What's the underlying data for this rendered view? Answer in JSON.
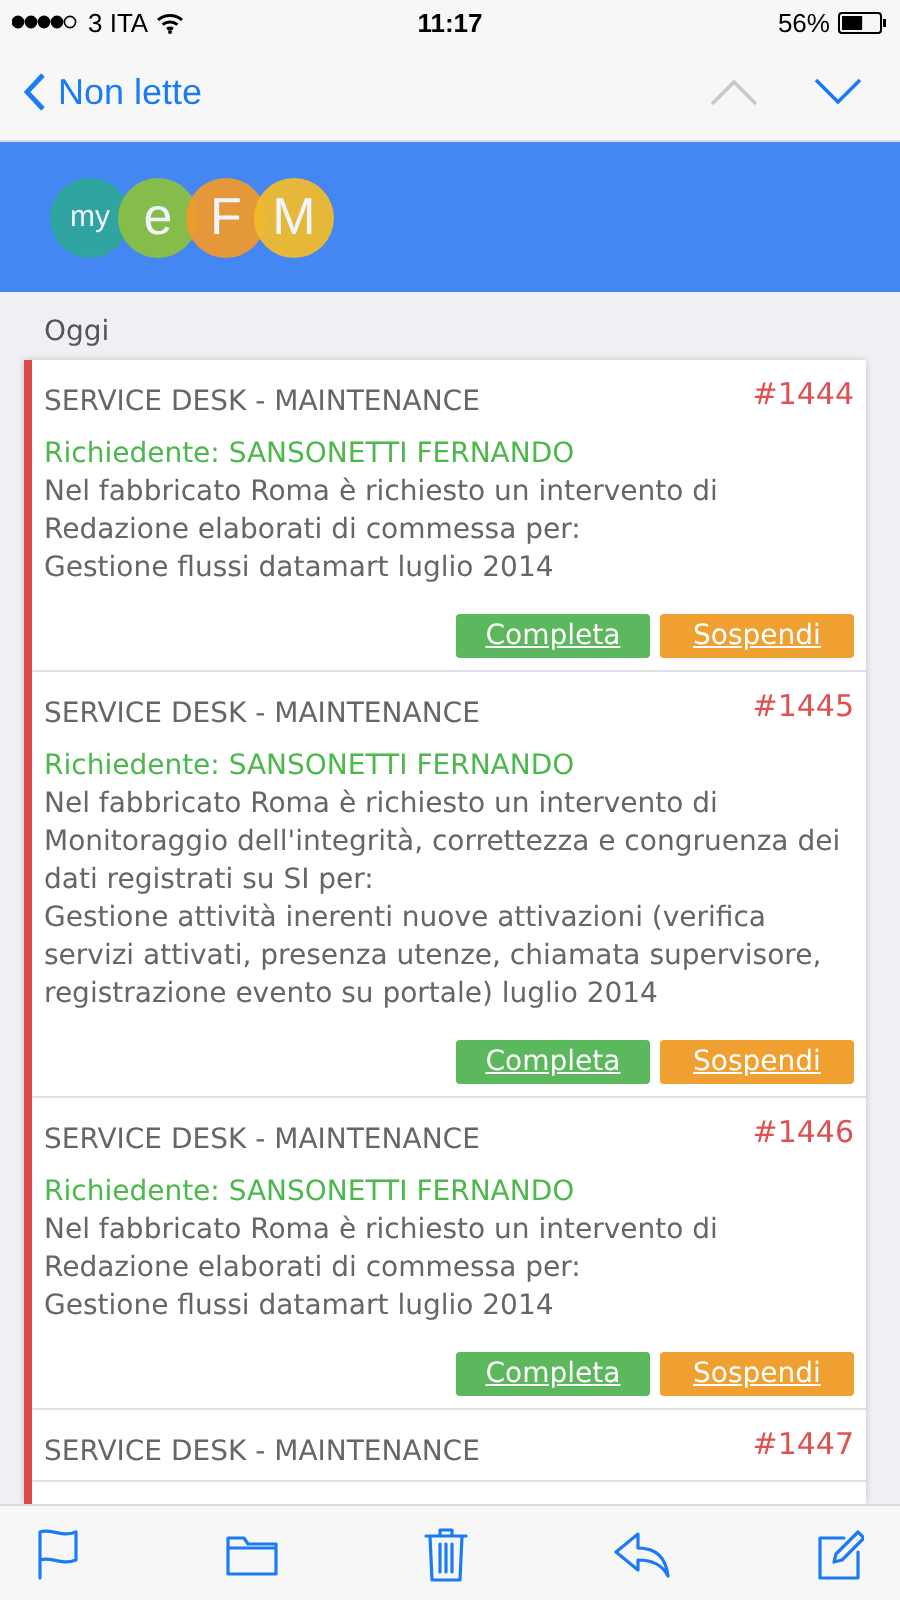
{
  "status_bar": {
    "carrier": "3 ITA",
    "time": "11:17",
    "battery": "56%"
  },
  "nav": {
    "back": "Non lette",
    "prev_disabled": true,
    "next_disabled": false
  },
  "logo": [
    "my",
    "e",
    "F",
    "M"
  ],
  "section": "Oggi",
  "cards": [
    {
      "title": "SERVICE DESK - MAINTENANCE",
      "number": "#1444",
      "requester": "Richiedente: SANSONETTI FERNANDO",
      "body": "Nel fabbricato Roma è richiesto un intervento di Redazione elaborati di commessa per:\nGestione flussi datamart luglio 2014",
      "actions": [
        "Completa",
        "Sospendi"
      ]
    },
    {
      "title": "SERVICE DESK - MAINTENANCE",
      "number": "#1445",
      "requester": "Richiedente: SANSONETTI FERNANDO",
      "body": "Nel fabbricato Roma è richiesto un intervento di Monitoraggio dell'integrità, correttezza e congruenza dei dati registrati su SI per:\nGestione attività inerenti nuove attivazioni (verifica servizi attivati, presenza utenze, chiamata supervisore, registrazione evento su portale) luglio 2014",
      "actions": [
        "Completa",
        "Sospendi"
      ]
    },
    {
      "title": "SERVICE DESK - MAINTENANCE",
      "number": "#1446",
      "requester": "Richiedente: SANSONETTI FERNANDO",
      "body": "Nel fabbricato Roma è richiesto un intervento di Redazione elaborati di commessa per:\nGestione flussi datamart luglio 2014",
      "actions": [
        "Completa",
        "Sospendi"
      ]
    },
    {
      "title": "SERVICE DESK - MAINTENANCE",
      "number": "#1447"
    }
  ]
}
